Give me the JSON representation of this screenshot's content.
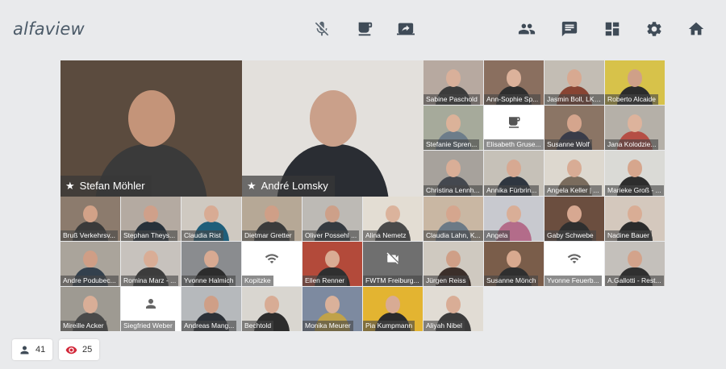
{
  "app": {
    "logo": "alfaview"
  },
  "toolbar_center": [
    {
      "name": "microphone-muted-icon"
    },
    {
      "name": "coffee-break-icon"
    },
    {
      "name": "screen-share-icon"
    }
  ],
  "toolbar_right": [
    {
      "name": "participants-icon"
    },
    {
      "name": "chat-icon"
    },
    {
      "name": "layout-grid-icon"
    },
    {
      "name": "settings-icon"
    },
    {
      "name": "home-icon"
    }
  ],
  "speakers": [
    {
      "name": "Stefan Möhler",
      "starred": true,
      "bg": "#5b4b3e",
      "skin": "#c49479",
      "shirt": "#3a3a3a"
    },
    {
      "name": "André Lomsky",
      "starred": true,
      "bg": "#e3e0dc",
      "skin": "#caa08a",
      "shirt": "#2a2d33"
    }
  ],
  "participants": [
    {
      "name": "Sabine Paschold",
      "bg": "#b7a9a0",
      "skin": "#d9b09a",
      "shirt": "#3b3b3b"
    },
    {
      "name": "Ann-Sophie Sp...",
      "bg": "#8a6f5f",
      "skin": "#dcb29b",
      "shirt": "#2e2e2e"
    },
    {
      "name": "Jasmin Boll, LK ...",
      "bg": "#c3bdb4",
      "skin": "#d8a991",
      "shirt": "#884433"
    },
    {
      "name": "Roberto Alcaide",
      "bg": "#d7c24a",
      "skin": "#cfa088",
      "shirt": "#2b2b2b"
    },
    {
      "name": "Stefanie Spren...",
      "bg": "#a6aa9b",
      "skin": "#dbb299",
      "shirt": "#6d7d8a"
    },
    {
      "name": "Elisabeth Gruse...",
      "bg": "#ffffff",
      "placeholder": "coffee"
    },
    {
      "name": "Susanne Wolf",
      "bg": "#8b7565",
      "skin": "#d5a58d",
      "shirt": "#3a3c49"
    },
    {
      "name": "Jana Kolodzie...",
      "bg": "#b5b0a8",
      "skin": "#ddb39c",
      "shirt": "#b54e45"
    },
    {
      "name": "Christina Lennh...",
      "bg": "#a7a29c",
      "skin": "#d9ae97",
      "shirt": "#44484f"
    },
    {
      "name": "Annika Fürbrin...",
      "bg": "#c6c1b8",
      "skin": "#d7a992",
      "shirt": "#2f3640"
    },
    {
      "name": "Angela Keller | ...",
      "bg": "#ddd8cf",
      "skin": "#d8ac95",
      "shirt": "#7a6c5d"
    },
    {
      "name": "Marieke Groß - ...",
      "bg": "#dadad6",
      "skin": "#d6a68d",
      "shirt": "#2d2d2d"
    },
    {
      "name": "Bruß Verkehrsv...",
      "bg": "#8c7b6d",
      "skin": "#d2a288",
      "shirt": "#3a3a3a"
    },
    {
      "name": "Stephan Theys...",
      "bg": "#b4aaa1",
      "skin": "#cfa08a",
      "shirt": "#27313a"
    },
    {
      "name": "Claudia Rist",
      "bg": "#cfc9c1",
      "skin": "#d8ab94",
      "shirt": "#1f5e7a"
    },
    {
      "name": "Dietmar Gretter",
      "bg": "#b6a896",
      "skin": "#cf9f87",
      "shirt": "#3b3b3b"
    },
    {
      "name": "Oliver Possehl ...",
      "bg": "#bdbab5",
      "skin": "#cda089",
      "shirt": "#343a40"
    },
    {
      "name": "Alina Nemetz",
      "bg": "#e3ddd3",
      "skin": "#dbb39c",
      "shirt": "#4a4a4a"
    },
    {
      "name": "Claudia Lahn, K...",
      "bg": "#c9b7a3",
      "skin": "#d5a68e",
      "shirt": "#6c7a86"
    },
    {
      "name": "Angela",
      "bg": "#c8c9cf",
      "skin": "#d9ae97",
      "shirt": "#b36c8a"
    },
    {
      "name": "Gaby Schwebe",
      "bg": "#6b4e3f",
      "skin": "#d7a891",
      "shirt": "#2f2f2f"
    },
    {
      "name": "Nadine Bauer",
      "bg": "#d4c8bd",
      "skin": "#d9ad95",
      "shirt": "#2b2b2b"
    },
    {
      "name": "Andre Podubec...",
      "bg": "#aaa49b",
      "skin": "#cf9e86",
      "shirt": "#33404d"
    },
    {
      "name": "Romina Marz - ...",
      "bg": "#c7c2bd",
      "skin": "#d9ad96",
      "shirt": "#3c3c3c"
    },
    {
      "name": "Yvonne Halmich",
      "bg": "#8a8c8f",
      "skin": "#d8aa92",
      "shirt": "#2c2c2c"
    },
    {
      "name": "Kopitzke",
      "bg": "#ffffff",
      "placeholder": "wifi"
    },
    {
      "name": "Ellen Renner",
      "bg": "#b34a3a",
      "skin": "#d9ac94",
      "shirt": "#2f2f2f"
    },
    {
      "name": "FWTM Freiburg...",
      "bg": "#6f6f6f",
      "placeholder": "camera-off"
    },
    {
      "name": "Jürgen Reiss",
      "bg": "#cfc9c0",
      "skin": "#cf9f87",
      "shirt": "#3b2f2a"
    },
    {
      "name": "Susanne Mönch",
      "bg": "#7a5d4a",
      "skin": "#d8a98f",
      "shirt": "#2f2f2f"
    },
    {
      "name": "Yvonne Feuerb...",
      "bg": "#ffffff",
      "placeholder": "wifi"
    },
    {
      "name": "A.Gallotti - Rest...",
      "bg": "#c4c0bb",
      "skin": "#d3a38b",
      "shirt": "#2f2f2f"
    },
    {
      "name": "Mireille Acker",
      "bg": "#9e9a92",
      "skin": "#d9ae97",
      "shirt": "#4a4a4a"
    },
    {
      "name": "Siegfried Weber",
      "bg": "#ffffff",
      "placeholder": "person"
    },
    {
      "name": "Andreas Mang...",
      "bg": "#b6b9bc",
      "skin": "#cf9f87",
      "shirt": "#2c3138"
    },
    {
      "name": "Bechtold",
      "bg": "#d9d6d0",
      "skin": "#d8ac95",
      "shirt": "#2c2c2c"
    },
    {
      "name": "Monika Meurer",
      "bg": "#7d8aa0",
      "skin": "#dab19a",
      "shirt": "#c0a24a"
    },
    {
      "name": "Pia Kumpmann",
      "bg": "#e3b431",
      "skin": "#d8ab94",
      "shirt": "#2b2b2b"
    },
    {
      "name": "Aliyah Nibel",
      "bg": "#e1dcd4",
      "skin": "#d9ad96",
      "shirt": "#3b3b3b"
    }
  ],
  "footer": {
    "participants_count": "41",
    "viewers_count": "25",
    "viewer_icon_color": "#d2283a"
  }
}
